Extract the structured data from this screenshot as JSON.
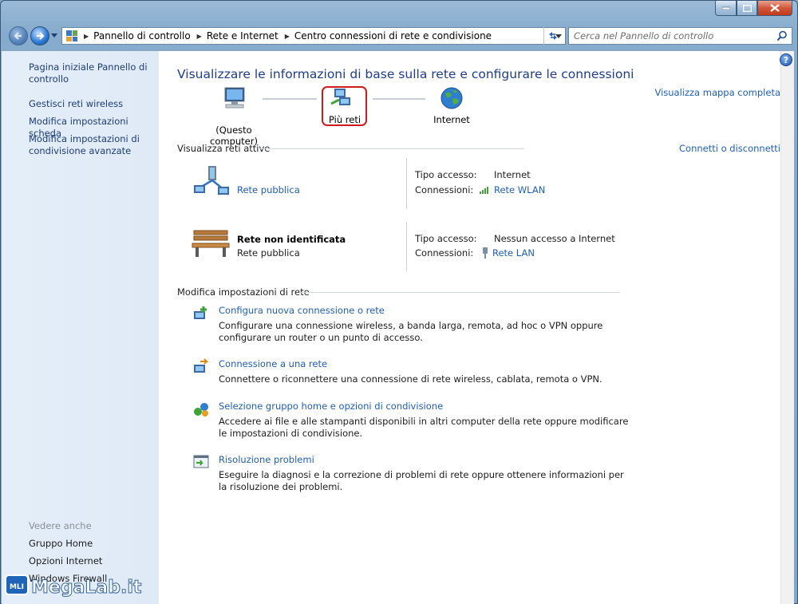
{
  "window": {
    "ghost_title": "",
    "breadcrumbs": [
      "Pannello di controllo",
      "Rete e Internet",
      "Centro connessioni di rete e condivisione"
    ],
    "search_placeholder": "Cerca nel Pannello di controllo"
  },
  "sidebar": {
    "home": "Pagina iniziale Pannello di controllo",
    "links": [
      "Gestisci reti wireless",
      "Modifica impostazioni scheda",
      "Modifica impostazioni di condivisione avanzate"
    ],
    "see_also_header": "Vedere anche",
    "see_also": [
      "Gruppo Home",
      "Opzioni Internet",
      "Windows Firewall"
    ]
  },
  "main": {
    "title": "Visualizzare le informazioni di base sulla rete e configurare le connessioni",
    "map_link": "Visualizza mappa completa",
    "map": {
      "computer_label": "(Questo computer)",
      "network_label": "Più reti",
      "internet_label": "Internet"
    },
    "active_header": "Visualizza reti attive",
    "connect_link": "Connetti o disconnetti",
    "networks": [
      {
        "name": "Rete pubblica",
        "type": "",
        "access_label": "Tipo accesso:",
        "access_value": "Internet",
        "conn_label": "Connessioni:",
        "conn_value": "Rete WLAN"
      },
      {
        "name": "Rete non identificata",
        "type": "Rete pubblica",
        "access_label": "Tipo accesso:",
        "access_value": "Nessun accesso a Internet",
        "conn_label": "Connessioni:",
        "conn_value": "Rete LAN"
      }
    ],
    "settings_header": "Modifica impostazioni di rete",
    "tasks": [
      {
        "title": "Configura nuova connessione o rete",
        "desc": "Configurare una connessione wireless, a banda larga, remota, ad hoc o VPN oppure configurare un router o un punto di accesso."
      },
      {
        "title": "Connessione a una rete",
        "desc": "Connettere o riconnettere una connessione di rete wireless, cablata, remota o VPN."
      },
      {
        "title": "Selezione gruppo home e opzioni di condivisione",
        "desc": "Accedere ai file e alle stampanti disponibili in altri computer della rete oppure modificare le impostazioni di condivisione."
      },
      {
        "title": "Risoluzione problemi",
        "desc": "Eseguire la diagnosi e la correzione di problemi di rete oppure ottenere informazioni per la risoluzione dei problemi."
      }
    ]
  },
  "watermark": {
    "text": "MegaLab.it",
    "badge": "MLI"
  },
  "colors": {
    "link": "#1e5fb5",
    "title": "#1e3d8b",
    "highlight": "#d01b1b",
    "sidebar_bg": "#e4eef9"
  }
}
